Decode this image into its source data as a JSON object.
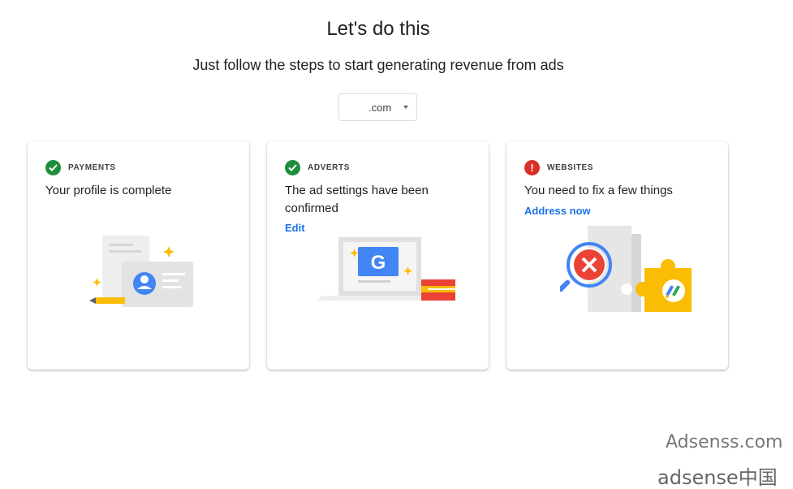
{
  "header": {
    "title": "Let's do this",
    "subtitle": "Just follow the steps to start generating revenue from ads"
  },
  "site_select": {
    "value": ".com"
  },
  "cards": [
    {
      "label": "PAYMENTS",
      "message": "Your profile is complete",
      "status": "complete",
      "status_color": "#1e8e3e"
    },
    {
      "label": "ADVERTS",
      "message": "The ad settings have been confirmed",
      "status": "complete",
      "status_color": "#1e8e3e",
      "link": "Edit"
    },
    {
      "label": "WEBSITES",
      "message": "You need to fix a few things",
      "status": "error",
      "status_color": "#d93025",
      "link": "Address now"
    }
  ],
  "watermark": {
    "line1": "Adsenss.com",
    "line2": "adsense中国"
  },
  "colors": {
    "link": "#1a73e8",
    "google_blue": "#4285f4",
    "google_yellow": "#fbbc04",
    "google_red": "#ea4335"
  }
}
